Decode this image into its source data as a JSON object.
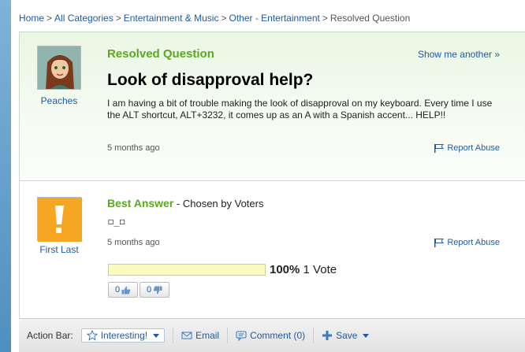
{
  "breadcrumb": {
    "items": [
      "Home",
      "All Categories",
      "Entertainment & Music",
      "Other - Entertainment"
    ],
    "current": "Resolved Question",
    "separator": ">"
  },
  "question": {
    "status": "Resolved Question",
    "show_another": "Show me another »",
    "title": "Look of disapproval help?",
    "body": "I am having a bit of trouble making the look of disapproval on my keyboard. Every time I use the ALT shortcut, ALT+3232, it comes up as an A with a Spanish accent... HELP!!",
    "time_ago": "5 months ago",
    "report": "Report Abuse",
    "asker": "Peaches"
  },
  "answer": {
    "label": "Best Answer",
    "chosen_by": " - Chosen by Voters",
    "text": "◻_◻",
    "time_ago": "5 months ago",
    "report": "Report Abuse",
    "answerer": "First Last",
    "vote_percent": "100%",
    "vote_count": "1 Vote",
    "vote_fraction": 1.0,
    "thumbs_up": "0",
    "thumbs_down": "0"
  },
  "action_bar": {
    "label": "Action Bar:",
    "interesting": "Interesting!",
    "email": "Email",
    "comment": "Comment (0)",
    "save": "Save"
  },
  "colors": {
    "link": "#1f5aa6",
    "accent_green": "#5aa81e",
    "vote_bar": "#fbfabf",
    "answerer_avatar": "#f5a623"
  },
  "icons": [
    "flag-icon",
    "thumbs-up-icon",
    "thumbs-down-icon",
    "star-icon",
    "envelope-icon",
    "comment-icon",
    "plus-icon",
    "caret-down-icon"
  ]
}
